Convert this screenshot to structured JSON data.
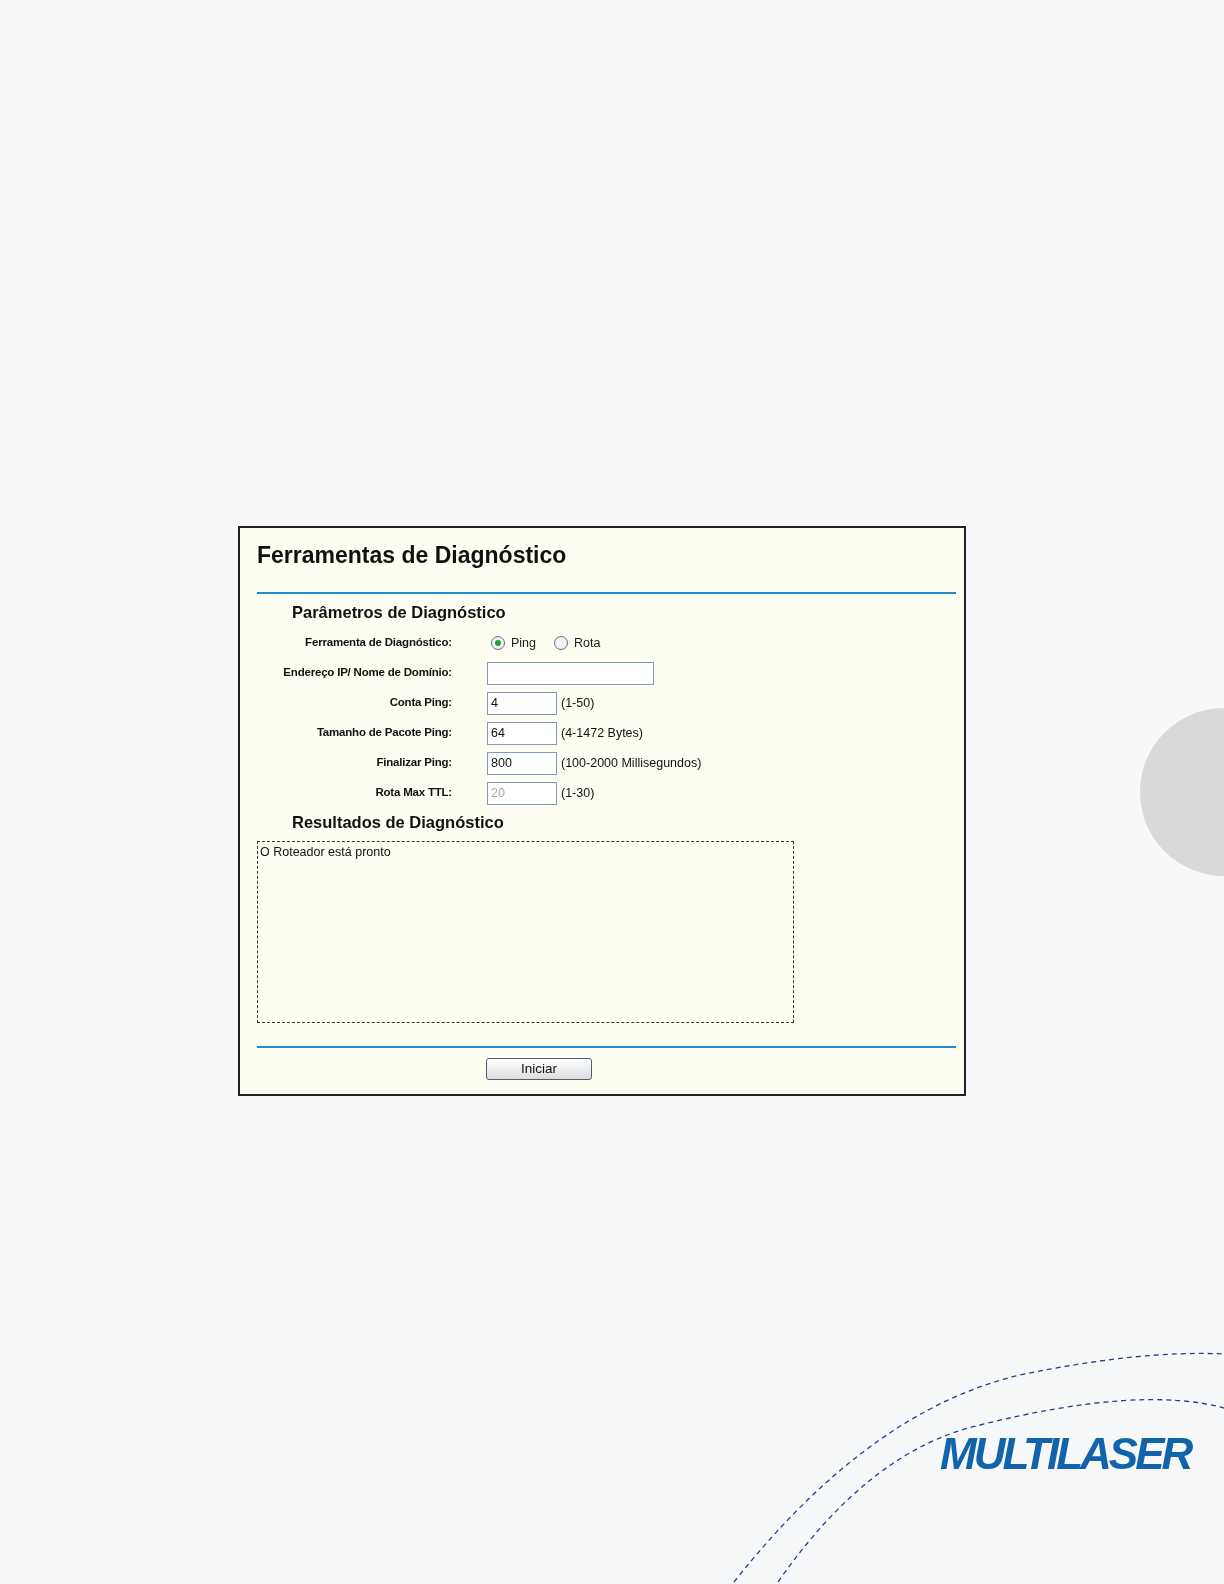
{
  "panel": {
    "title": "Ferramentas de Diagnóstico",
    "parameters": {
      "heading": "Parâmetros de Diagnóstico",
      "fields": [
        {
          "kind": "radio",
          "label": "Ferramenta de Diagnóstico:",
          "options": [
            {
              "label": "Ping",
              "selected": true
            },
            {
              "label": "Rota",
              "selected": false
            }
          ]
        },
        {
          "kind": "text",
          "label": "Endereço IP/ Nome de Domínio:",
          "wide": true,
          "disabled": false
        },
        {
          "kind": "text",
          "label": "Conta Ping:",
          "value": "4",
          "hint": "(1-50)",
          "disabled": false
        },
        {
          "kind": "text",
          "label": "Tamanho de Pacote Ping:",
          "value": "64",
          "hint": "(4-1472 Bytes)",
          "disabled": false
        },
        {
          "kind": "text",
          "label": "Finalizar Ping:",
          "value": "800",
          "hint": "(100-2000 Millisegundos)",
          "disabled": false
        },
        {
          "kind": "text",
          "label": "Rota Max TTL:",
          "value": "20",
          "hint": "(1-30)",
          "disabled": true
        }
      ]
    },
    "results": {
      "heading": "Resultados de Diagnóstico",
      "text": "O Roteador está pronto"
    },
    "start_button": "Iniciar"
  },
  "brand": {
    "logo": "MULTILASER"
  }
}
